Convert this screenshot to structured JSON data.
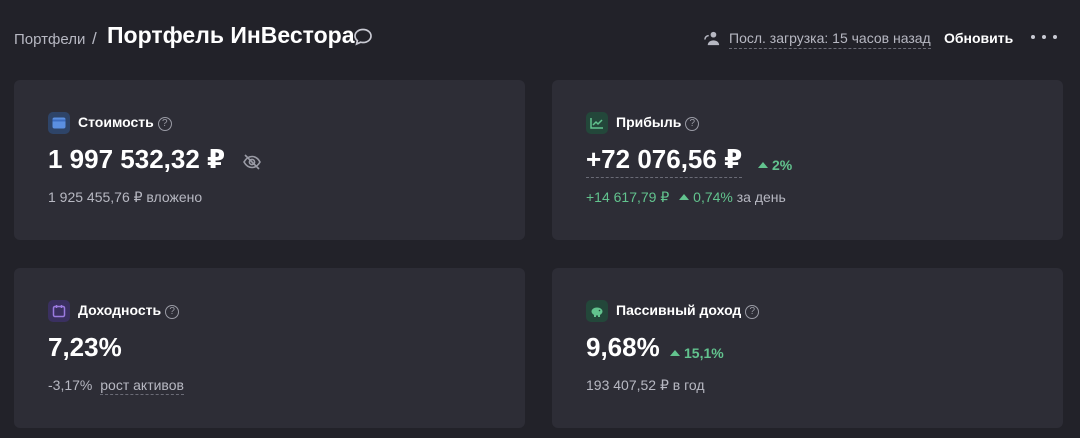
{
  "header": {
    "breadcrumb_root": "Портфели",
    "breadcrumb_sep": "/",
    "title": "Портфель ИнВестора",
    "last_load": "Посл. загрузка: 15 часов назад",
    "refresh_label": "Обновить"
  },
  "cards": {
    "value": {
      "label": "Стоимость",
      "amount": "1 997 532,32 ₽",
      "invested": "1 925 455,76 ₽ вложено",
      "icon": "wallet-icon",
      "icon_color": "#5b8fe0"
    },
    "profit": {
      "label": "Прибыль",
      "amount": "+72 076,56 ₽",
      "percent": "2%",
      "day_amount": "+14 617,79 ₽",
      "day_percent": "0,74%",
      "day_suffix": "за день",
      "icon": "chart-icon",
      "icon_color": "#62c38e"
    },
    "yield": {
      "label": "Доходность",
      "amount": "7,23%",
      "change": "-3,17%",
      "link": "рост активов",
      "icon": "calendar-icon",
      "icon_color": "#9b7be0"
    },
    "passive": {
      "label": "Пассивный доход",
      "amount": "9,68%",
      "percent": "15,1%",
      "yearly": "193 407,52 ₽ в год",
      "icon": "piggy-bank-icon",
      "icon_color": "#62c38e"
    }
  },
  "colors": {
    "background": "#222229",
    "card": "#2d2d36",
    "positive": "#62c38e"
  }
}
